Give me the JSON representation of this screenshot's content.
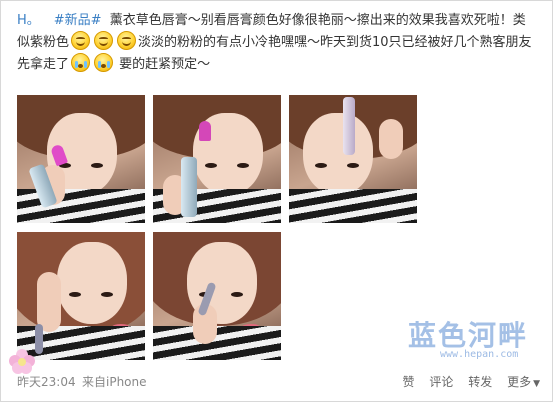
{
  "post": {
    "author": "H。",
    "tag": "#新品#",
    "text_1": " 薰衣草色唇膏～别看唇膏颜色好像很艳丽～擦出来的效果我喜欢死啦！类似紫粉色",
    "text_2": "淡淡的粉粉的有点小冷艳嘿嘿～昨天到货10只已经被好几个熟客朋友先拿走了",
    "text_3": "要的赶紧预定～",
    "emoji_names": [
      "smile-emoji",
      "smile-emoji",
      "smile-emoji",
      "cry-emoji",
      "cry-emoji"
    ]
  },
  "photos": [
    {
      "name": "photo-1",
      "stick_color": "#e04bc8"
    },
    {
      "name": "photo-2",
      "stick_color": "#d447b8"
    },
    {
      "name": "photo-3",
      "stick_color": "#c8c8d8"
    },
    {
      "name": "photo-4",
      "stick_color": "#8d8fa8"
    },
    {
      "name": "photo-5",
      "stick_color": "#9a9bb0"
    }
  ],
  "footer": {
    "time": "昨天23:04",
    "source": "来自iPhone",
    "like": "赞",
    "comment": "评论",
    "repost": "转发",
    "more": "更多",
    "more_icon": "chevron-down-icon"
  },
  "watermark": {
    "text": "蓝色河畔",
    "url": "www.hepan.com"
  },
  "colors": {
    "link": "#3a7fc4",
    "meta": "#888888"
  }
}
